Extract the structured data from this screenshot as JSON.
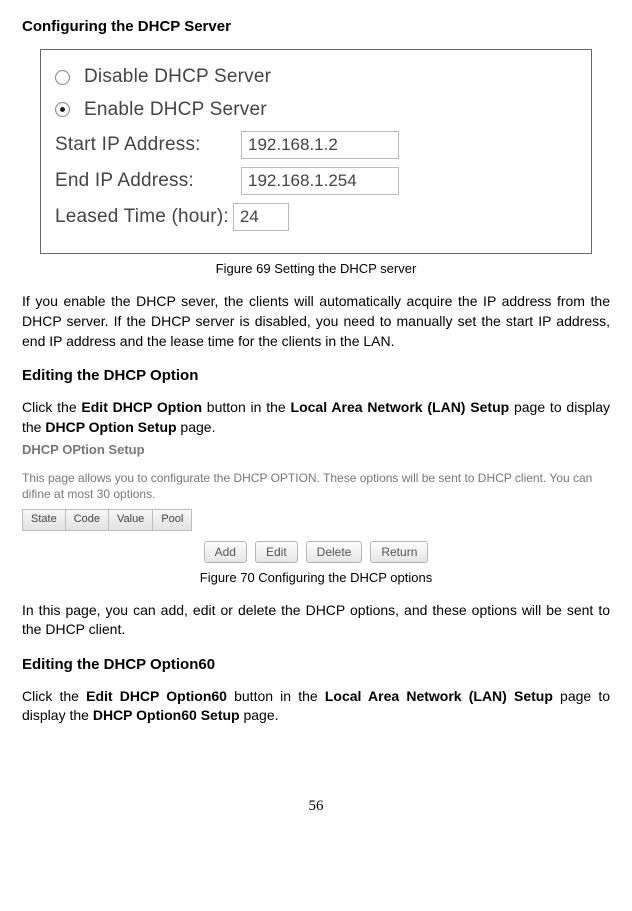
{
  "h1": "Configuring the DHCP Server",
  "fig1": {
    "radio_disable": "Disable DHCP Server",
    "radio_enable": "Enable DHCP Server",
    "start_label": "Start IP Address:",
    "start_value": "192.168.1.2",
    "end_label": "End IP Address:",
    "end_value": "192.168.1.254",
    "leased_label": "Leased Time (hour):",
    "leased_value": "24",
    "caption": "Figure 69 Setting the DHCP server"
  },
  "p1_a": "If you enable the DHCP sever, the clients will automatically acquire the IP address from the DHCP server. If the DHCP server is disabled, you need to manually set the start IP address, end IP address and the lease time for the clients in the LAN.",
  "h2": "Editing the DHCP Option",
  "p2_1": "Click the ",
  "p2_b1": "Edit DHCP Option",
  "p2_2": " button in the ",
  "p2_b2": "Local Area Network (LAN) Setup",
  "p2_3": " page to display the ",
  "p2_b3": "DHCP Option Setup",
  "p2_4": " page.",
  "fig2": {
    "title": "DHCP OPtion Setup",
    "desc": "This page allows you to configurate the DHCP OPTION. These options will be sent to DHCP client. You can difine at most 30 options.",
    "cols": [
      "State",
      "Code",
      "Value",
      "Pool"
    ],
    "buttons": [
      "Add",
      "Edit",
      "Delete",
      "Return"
    ],
    "caption": "Figure 70 Configuring the DHCP options"
  },
  "p3": "In this page, you can add, edit or delete the DHCP options, and these options will be sent to the DHCP client.",
  "h3": "Editing the DHCP Option60",
  "p4_1": "Click the ",
  "p4_b1": "Edit DHCP Option60",
  "p4_2": " button in the ",
  "p4_b2": "Local Area Network (LAN) Setup",
  "p4_3": " page to display the ",
  "p4_b3": "DHCP Option60 Setup",
  "p4_4": " page.",
  "page_num": "56"
}
